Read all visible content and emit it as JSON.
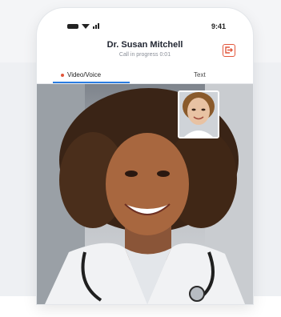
{
  "status_bar": {
    "time": "9:41"
  },
  "call": {
    "doctor_name": "Dr. Susan Mitchell",
    "status": "Call in progress 0:01"
  },
  "tabs": [
    {
      "label": "Video/Voice",
      "active": true
    },
    {
      "label": "Text",
      "active": false
    }
  ],
  "icons": {
    "exit": "exit-call-icon",
    "record": "recording-dot-icon",
    "wifi": "wifi-icon",
    "signal": "signal-icon",
    "battery": "battery-icon"
  },
  "colors": {
    "accent": "#e2563b",
    "tab_active": "#2a7de1"
  }
}
